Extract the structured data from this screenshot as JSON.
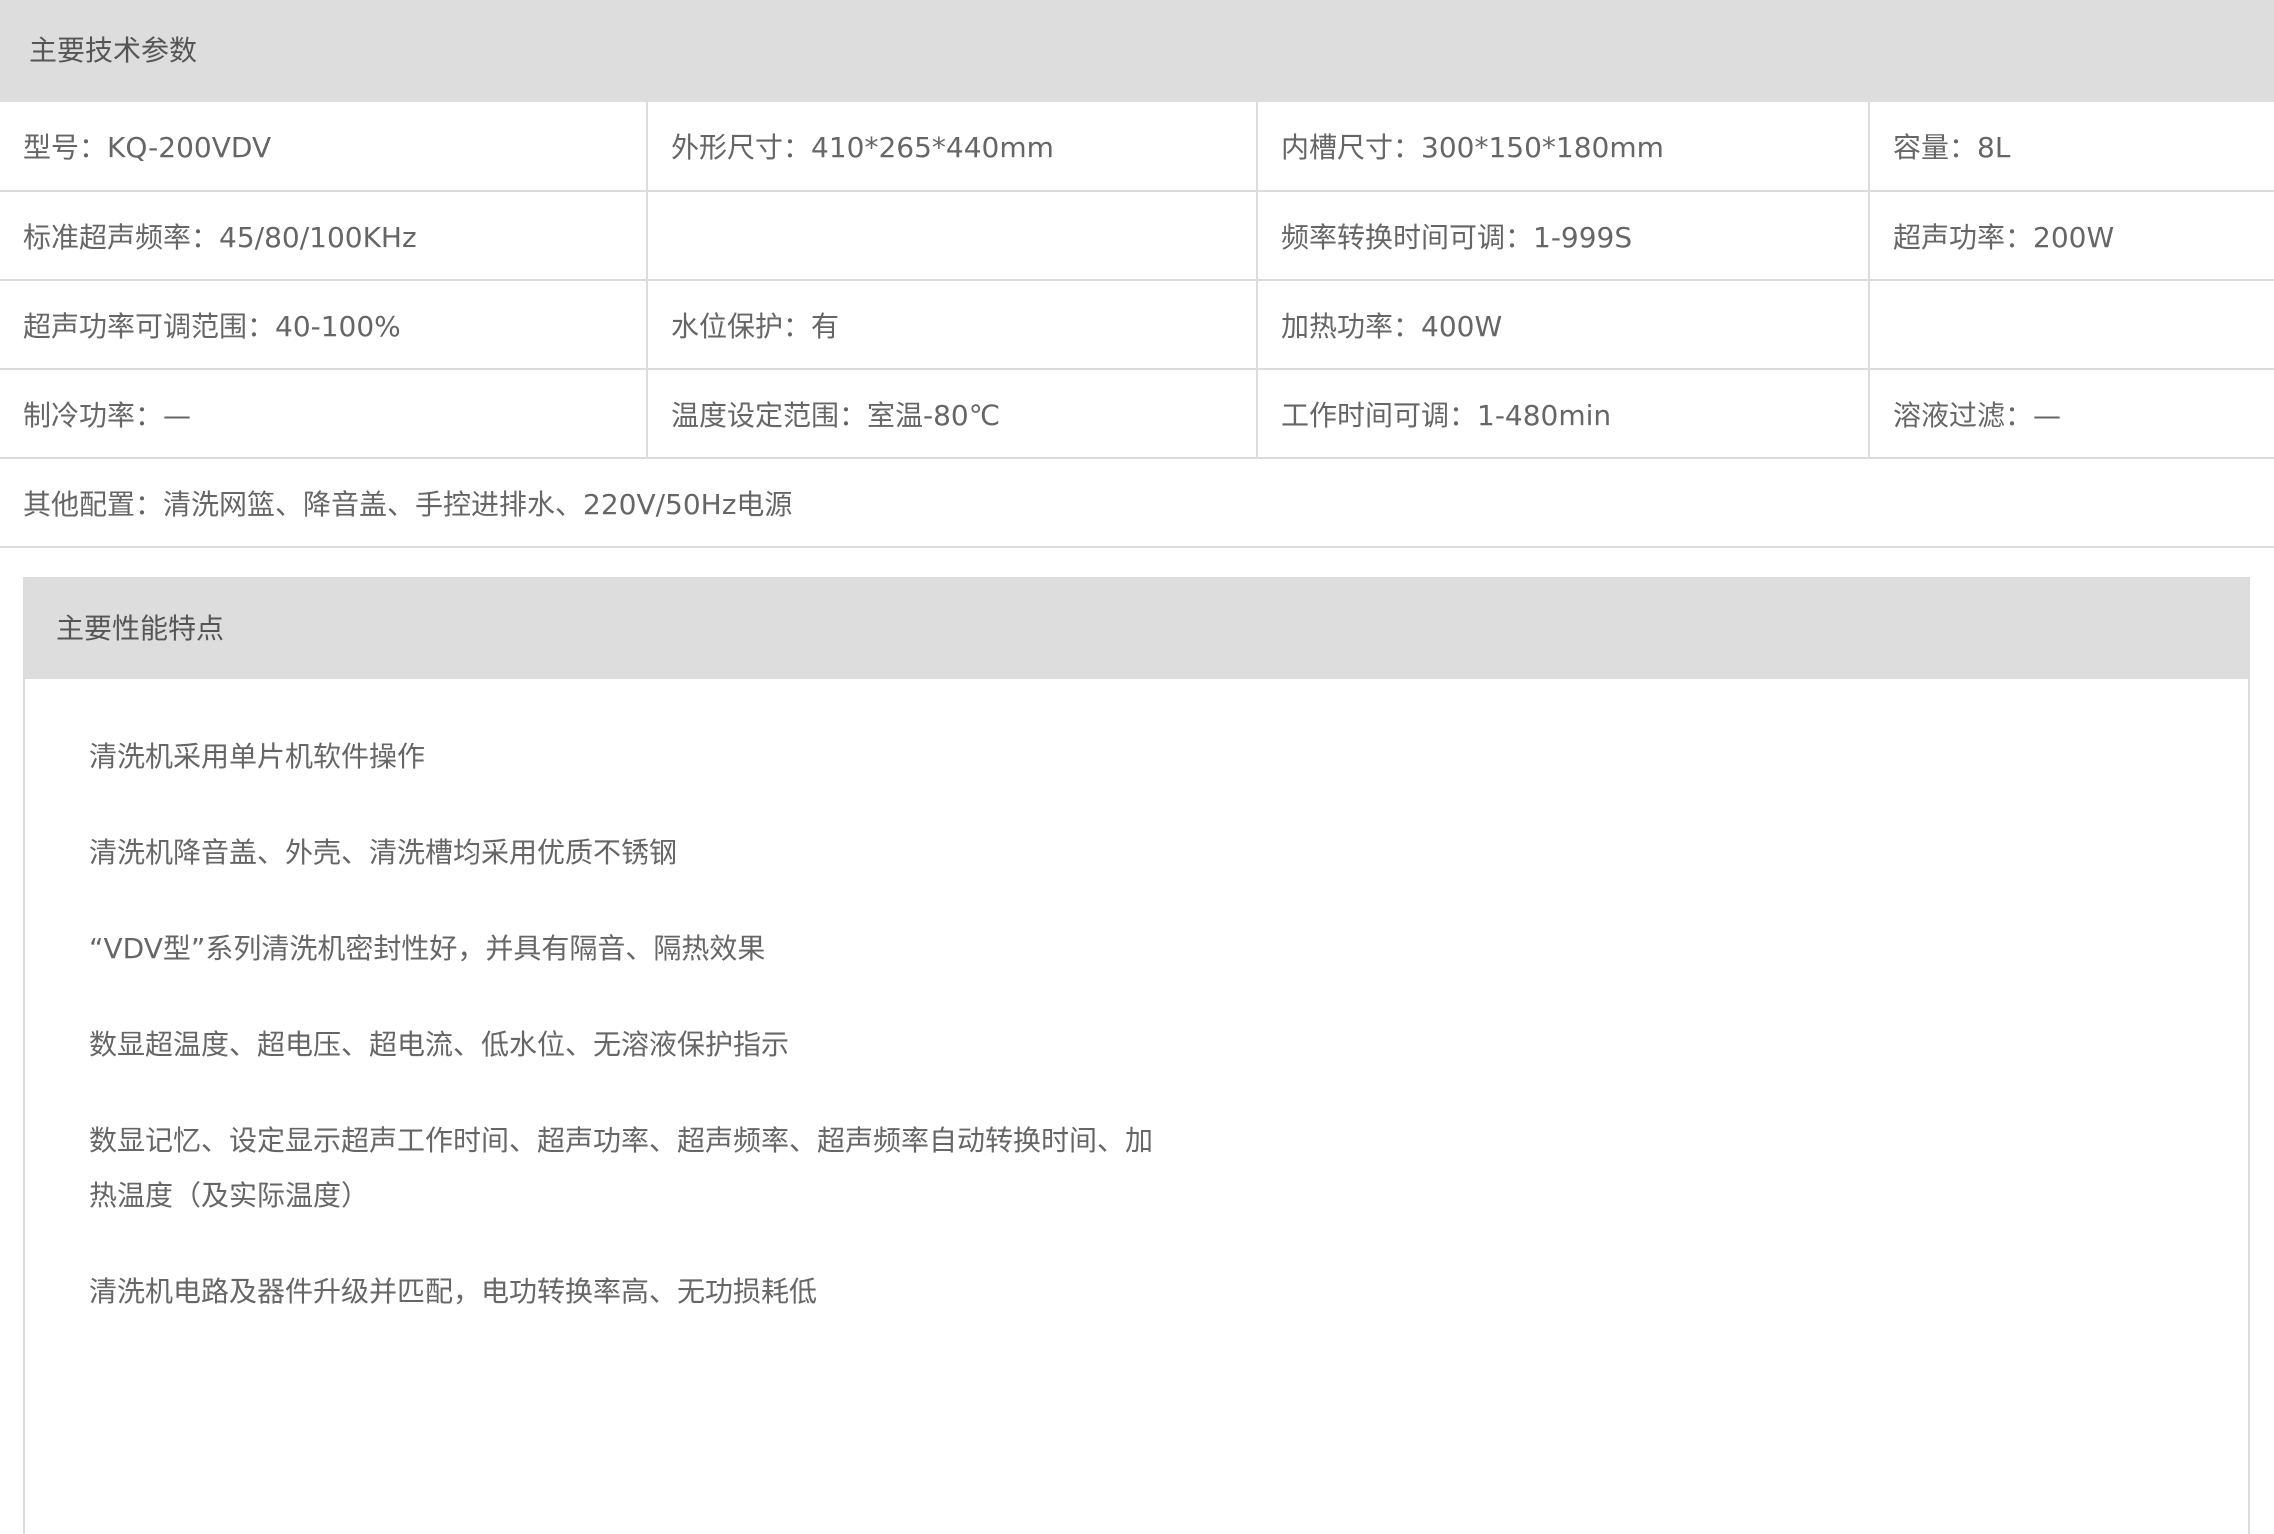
{
  "specs": {
    "title": "主要技术参数",
    "rows": [
      [
        "型号：KQ-200VDV",
        "外形尺寸：410*265*440mm",
        "内槽尺寸：300*150*180mm",
        "容量：8L"
      ],
      [
        "标准超声频率：45/80/100KHz",
        "",
        "频率转换时间可调：1-999S",
        "超声功率：200W"
      ],
      [
        "超声功率可调范围：40-100%",
        "水位保护：有",
        "加热功率：400W",
        ""
      ],
      [
        "制冷功率：—",
        "温度设定范围：室温-80℃",
        "工作时间可调：1-480min",
        "溶液过滤：—"
      ]
    ],
    "other": "其他配置：清洗网篮、降音盖、手控进排水、220V/50Hz电源"
  },
  "features": {
    "title": "主要性能特点",
    "items": [
      "清洗机采用单片机软件操作",
      "清洗机降音盖、外壳、清洗槽均采用优质不锈钢",
      "“VDV型”系列清洗机密封性好，并具有隔音、隔热效果",
      "数显超温度、超电压、超电流、低水位、无溶液保护指示",
      "数显记忆、设定显示超声工作时间、超声功率、超声频率、超声频率自动转换时间、加热温度（及实际温度）",
      "清洗机电路及器件升级并匹配，电功转换率高、无功损耗低"
    ]
  }
}
